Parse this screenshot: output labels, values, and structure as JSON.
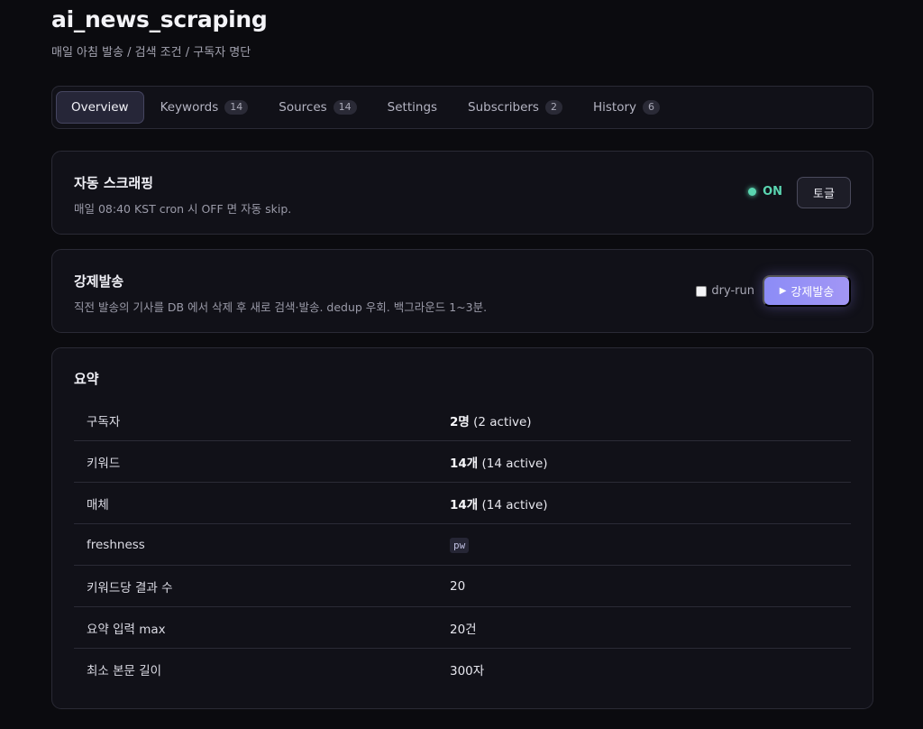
{
  "page": {
    "title": "ai_news_scraping",
    "subtitle": "매일 아침 발송 / 검색 조건 / 구독자 명단"
  },
  "tabs": [
    {
      "label": "Overview",
      "count": null,
      "active": true
    },
    {
      "label": "Keywords",
      "count": "14"
    },
    {
      "label": "Sources",
      "count": "14"
    },
    {
      "label": "Settings",
      "count": null
    },
    {
      "label": "Subscribers",
      "count": "2"
    },
    {
      "label": "History",
      "count": "6"
    }
  ],
  "auto_scraping": {
    "title": "자동 스크래핑",
    "description": "매일 08:40 KST cron 시 OFF 면 자동 skip.",
    "status": "ON",
    "status_color": "#5ad5b0",
    "toggle_label": "토글"
  },
  "force_send": {
    "title": "강제발송",
    "description": "직전 발송의 기사를 DB 에서 삭제 후 새로 검색·발송. dedup 우회. 백그라운드 1~3분.",
    "dryrun_label": "dry-run",
    "dryrun_checked": false,
    "button_icon": "play-icon",
    "button_label": "강제발송",
    "accent": "#8c8cf6"
  },
  "summary": {
    "title": "요약",
    "rows": [
      {
        "label": "구독자",
        "value_bold": "2명",
        "value_rest": " (2 active)"
      },
      {
        "label": "키워드",
        "value_bold": "14개",
        "value_rest": " (14 active)"
      },
      {
        "label": "매체",
        "value_bold": "14개",
        "value_rest": " (14 active)"
      },
      {
        "label": "freshness",
        "value_code": "pw"
      },
      {
        "label": "키워드당 결과 수",
        "value": "20"
      },
      {
        "label": "요약 입력 max",
        "value": "20건"
      },
      {
        "label": "최소 본문 길이",
        "value": "300자"
      }
    ]
  }
}
